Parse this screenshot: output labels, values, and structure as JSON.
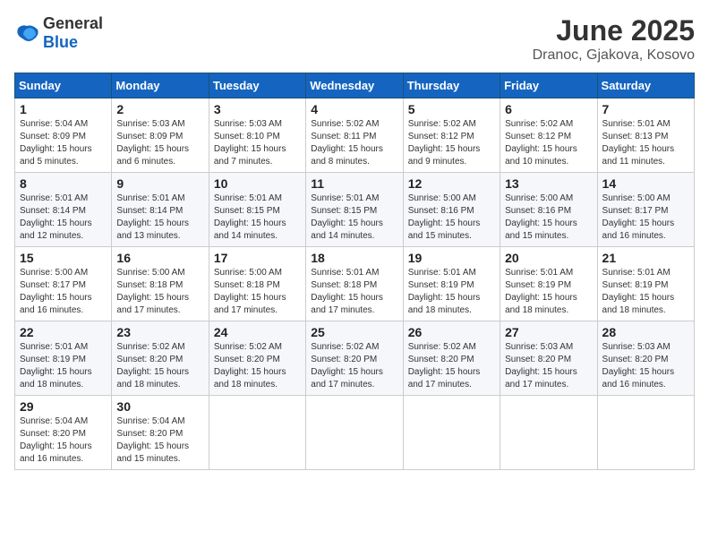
{
  "logo": {
    "general": "General",
    "blue": "Blue"
  },
  "title": "June 2025",
  "location": "Dranoc, Gjakova, Kosovo",
  "weekdays": [
    "Sunday",
    "Monday",
    "Tuesday",
    "Wednesday",
    "Thursday",
    "Friday",
    "Saturday"
  ],
  "weeks": [
    [
      {
        "day": "1",
        "info": "Sunrise: 5:04 AM\nSunset: 8:09 PM\nDaylight: 15 hours\nand 5 minutes."
      },
      {
        "day": "2",
        "info": "Sunrise: 5:03 AM\nSunset: 8:09 PM\nDaylight: 15 hours\nand 6 minutes."
      },
      {
        "day": "3",
        "info": "Sunrise: 5:03 AM\nSunset: 8:10 PM\nDaylight: 15 hours\nand 7 minutes."
      },
      {
        "day": "4",
        "info": "Sunrise: 5:02 AM\nSunset: 8:11 PM\nDaylight: 15 hours\nand 8 minutes."
      },
      {
        "day": "5",
        "info": "Sunrise: 5:02 AM\nSunset: 8:12 PM\nDaylight: 15 hours\nand 9 minutes."
      },
      {
        "day": "6",
        "info": "Sunrise: 5:02 AM\nSunset: 8:12 PM\nDaylight: 15 hours\nand 10 minutes."
      },
      {
        "day": "7",
        "info": "Sunrise: 5:01 AM\nSunset: 8:13 PM\nDaylight: 15 hours\nand 11 minutes."
      }
    ],
    [
      {
        "day": "8",
        "info": "Sunrise: 5:01 AM\nSunset: 8:14 PM\nDaylight: 15 hours\nand 12 minutes."
      },
      {
        "day": "9",
        "info": "Sunrise: 5:01 AM\nSunset: 8:14 PM\nDaylight: 15 hours\nand 13 minutes."
      },
      {
        "day": "10",
        "info": "Sunrise: 5:01 AM\nSunset: 8:15 PM\nDaylight: 15 hours\nand 14 minutes."
      },
      {
        "day": "11",
        "info": "Sunrise: 5:01 AM\nSunset: 8:15 PM\nDaylight: 15 hours\nand 14 minutes."
      },
      {
        "day": "12",
        "info": "Sunrise: 5:00 AM\nSunset: 8:16 PM\nDaylight: 15 hours\nand 15 minutes."
      },
      {
        "day": "13",
        "info": "Sunrise: 5:00 AM\nSunset: 8:16 PM\nDaylight: 15 hours\nand 15 minutes."
      },
      {
        "day": "14",
        "info": "Sunrise: 5:00 AM\nSunset: 8:17 PM\nDaylight: 15 hours\nand 16 minutes."
      }
    ],
    [
      {
        "day": "15",
        "info": "Sunrise: 5:00 AM\nSunset: 8:17 PM\nDaylight: 15 hours\nand 16 minutes."
      },
      {
        "day": "16",
        "info": "Sunrise: 5:00 AM\nSunset: 8:18 PM\nDaylight: 15 hours\nand 17 minutes."
      },
      {
        "day": "17",
        "info": "Sunrise: 5:00 AM\nSunset: 8:18 PM\nDaylight: 15 hours\nand 17 minutes."
      },
      {
        "day": "18",
        "info": "Sunrise: 5:01 AM\nSunset: 8:18 PM\nDaylight: 15 hours\nand 17 minutes."
      },
      {
        "day": "19",
        "info": "Sunrise: 5:01 AM\nSunset: 8:19 PM\nDaylight: 15 hours\nand 18 minutes."
      },
      {
        "day": "20",
        "info": "Sunrise: 5:01 AM\nSunset: 8:19 PM\nDaylight: 15 hours\nand 18 minutes."
      },
      {
        "day": "21",
        "info": "Sunrise: 5:01 AM\nSunset: 8:19 PM\nDaylight: 15 hours\nand 18 minutes."
      }
    ],
    [
      {
        "day": "22",
        "info": "Sunrise: 5:01 AM\nSunset: 8:19 PM\nDaylight: 15 hours\nand 18 minutes."
      },
      {
        "day": "23",
        "info": "Sunrise: 5:02 AM\nSunset: 8:20 PM\nDaylight: 15 hours\nand 18 minutes."
      },
      {
        "day": "24",
        "info": "Sunrise: 5:02 AM\nSunset: 8:20 PM\nDaylight: 15 hours\nand 18 minutes."
      },
      {
        "day": "25",
        "info": "Sunrise: 5:02 AM\nSunset: 8:20 PM\nDaylight: 15 hours\nand 17 minutes."
      },
      {
        "day": "26",
        "info": "Sunrise: 5:02 AM\nSunset: 8:20 PM\nDaylight: 15 hours\nand 17 minutes."
      },
      {
        "day": "27",
        "info": "Sunrise: 5:03 AM\nSunset: 8:20 PM\nDaylight: 15 hours\nand 17 minutes."
      },
      {
        "day": "28",
        "info": "Sunrise: 5:03 AM\nSunset: 8:20 PM\nDaylight: 15 hours\nand 16 minutes."
      }
    ],
    [
      {
        "day": "29",
        "info": "Sunrise: 5:04 AM\nSunset: 8:20 PM\nDaylight: 15 hours\nand 16 minutes."
      },
      {
        "day": "30",
        "info": "Sunrise: 5:04 AM\nSunset: 8:20 PM\nDaylight: 15 hours\nand 15 minutes."
      },
      null,
      null,
      null,
      null,
      null
    ]
  ]
}
